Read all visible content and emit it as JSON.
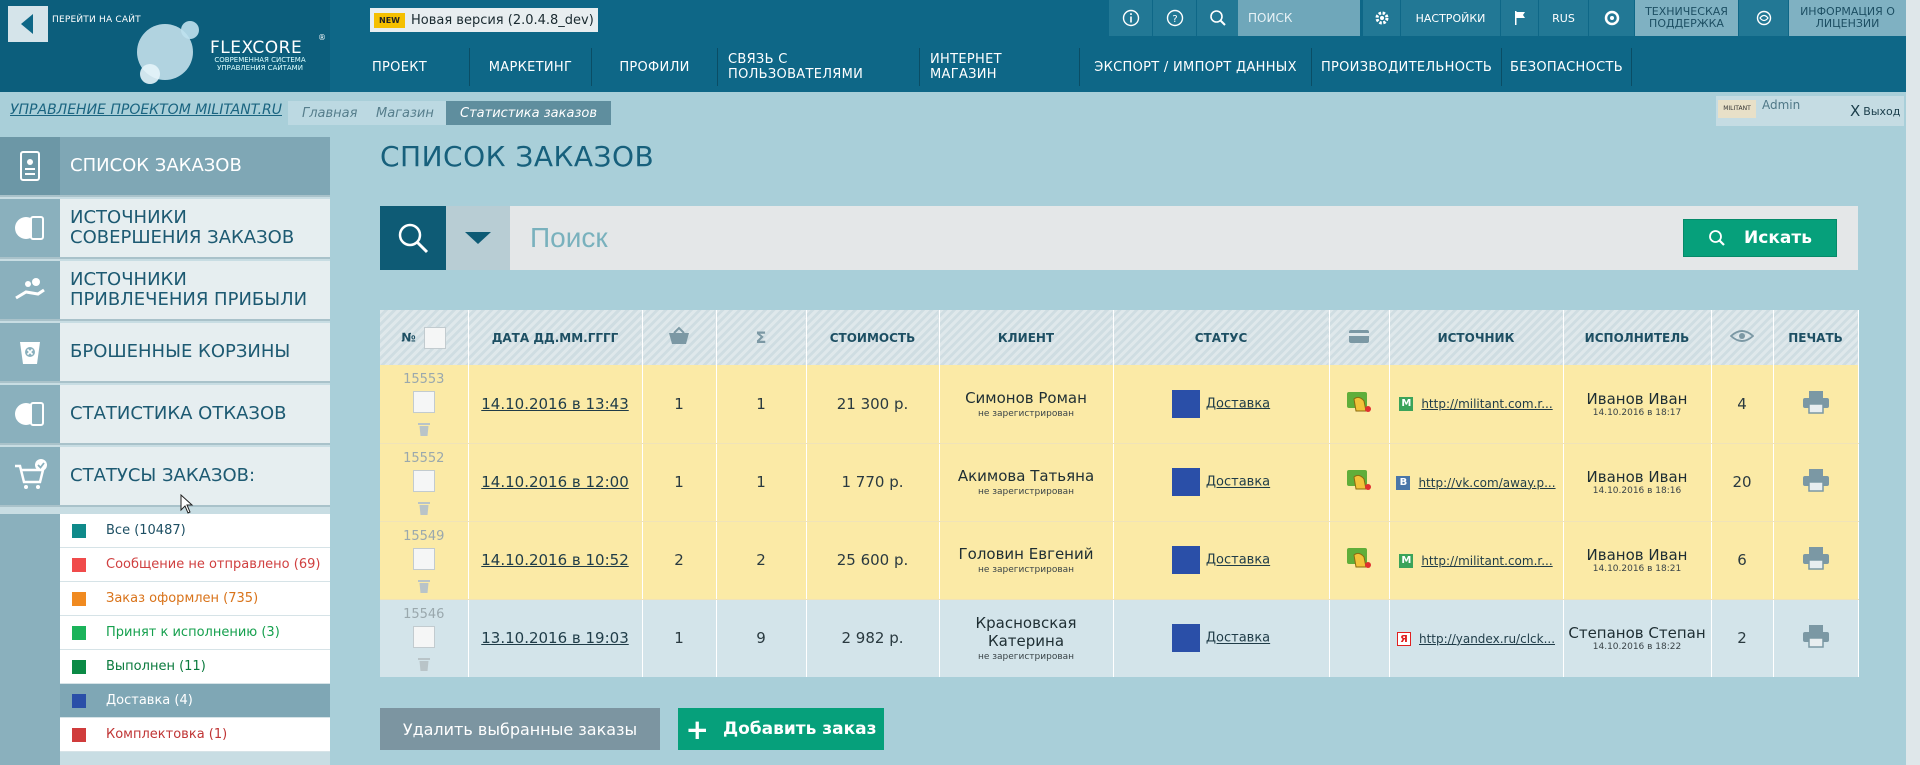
{
  "header": {
    "back_label": "ПЕРЕЙТИ НА САЙТ",
    "brand": "FLEXCORE",
    "brand_reg": "®",
    "tagline": "СОВРЕМЕННАЯ СИСТЕМА УПРАВЛЕНИЯ САЙТАМИ",
    "new_badge": "NEW",
    "version": "Новая версия (2.0.4.8_dev)",
    "search_placeholder": "ПОИСК",
    "settings": "НАСТРОЙКИ",
    "lang": "RUS",
    "support": "ТЕХНИЧЕСКАЯ ПОДДЕРЖКА",
    "license": "ИНФОРМАЦИЯ О ЛИЦЕНЗИИ"
  },
  "nav": [
    "ПРОЕКТ",
    "МАРКЕТИНГ",
    "ПРОФИЛИ",
    "СВЯЗЬ С ПОЛЬЗОВАТЕЛЯМИ",
    "ИНТЕРНЕТ МАГАЗИН",
    "ЭКСПОРТ / ИМПОРТ ДАННЫХ",
    "ПРОИЗВОДИТЕЛЬНОСТЬ",
    "БЕЗОПАСНОСТЬ"
  ],
  "breadcrumb": {
    "project": "УПРАВЛЕНИЕ ПРОЕКТОМ MILITANT.RU",
    "items": [
      "Главная",
      "Магазин",
      "Статистика заказов"
    ]
  },
  "user": {
    "logo": "MILITANT",
    "name": "Admin",
    "logout_x": "X",
    "logout": "Выход"
  },
  "sidebar": {
    "items": [
      "СПИСОК ЗАКАЗОВ",
      "ИСТОЧНИКИ СОВЕРШЕНИЯ ЗАКАЗОВ",
      "ИСТОЧНИКИ ПРИВЛЕЧЕНИЯ ПРИБЫЛИ",
      "БРОШЕННЫЕ КОРЗИНЫ",
      "СТАТИСТИКА ОТКАЗОВ",
      "СТАТУСЫ ЗАКАЗОВ:"
    ],
    "statuses": [
      {
        "label": "Все (10487)",
        "color": "#0f8a8a",
        "text": "#1d4f63"
      },
      {
        "label": "Сообщение не отправлено (69)",
        "color": "#f04b4b",
        "text": "#d04040"
      },
      {
        "label": "Заказ оформлен (735)",
        "color": "#f08a20",
        "text": "#d9731a"
      },
      {
        "label": "Принят к исполнению (3)",
        "color": "#1bb35a",
        "text": "#16a04e"
      },
      {
        "label": "Выполнен (11)",
        "color": "#0b8a45",
        "text": "#0a7a3d"
      },
      {
        "label": "Доставка (4)",
        "color": "#2a4fa8",
        "text": "#ffffff"
      },
      {
        "label": "Комплектовка (1)",
        "color": "#d03c3c",
        "text": "#c03535"
      }
    ]
  },
  "page_title": "СПИСОК ЗАКАЗОВ",
  "search": {
    "placeholder": "Поиск",
    "button": "Искать"
  },
  "table": {
    "headers": {
      "num": "№",
      "date": "ДАТА ДД.ММ.ГГГГ",
      "sum": "Σ",
      "cost": "СТОИМОСТЬ",
      "client": "КЛИЕНТ",
      "status": "СТАТУС",
      "source": "ИСТОЧНИК",
      "executor": "ИСПОЛНИТЕЛЬ",
      "print": "ПЕЧАТЬ"
    },
    "rows": [
      {
        "id": "15553",
        "date": "14.10.2016 в 13:43",
        "qty": "1",
        "sum": "1",
        "cost": "21 300 р.",
        "client": "Симонов Роман",
        "client_note": "не зарегистрирован",
        "status": "Доставка",
        "src_icon": "M",
        "source": "http://militant.com.r...",
        "executor": "Иванов Иван",
        "exec_date": "14.10.2016 в 18:17",
        "views": "4"
      },
      {
        "id": "15552",
        "date": "14.10.2016 в 12:00",
        "qty": "1",
        "sum": "1",
        "cost": "1 770 р.",
        "client": "Акимова Татьяна",
        "client_note": "не зарегистрирован",
        "status": "Доставка",
        "src_icon": "В",
        "source": "http://vk.com/away.p...",
        "executor": "Иванов Иван",
        "exec_date": "14.10.2016 в 18:16",
        "views": "20"
      },
      {
        "id": "15549",
        "date": "14.10.2016 в 10:52",
        "qty": "2",
        "sum": "2",
        "cost": "25 600 р.",
        "client": "Головин Евгений",
        "client_note": "не зарегистрирован",
        "status": "Доставка",
        "src_icon": "M",
        "source": "http://militant.com.r...",
        "executor": "Иванов Иван",
        "exec_date": "14.10.2016 в 18:21",
        "views": "6"
      },
      {
        "id": "15546",
        "date": "13.10.2016 в 19:03",
        "qty": "1",
        "sum": "9",
        "cost": "2 982 р.",
        "client": "Красновская Катерина",
        "client_note": "не зарегистрирован",
        "status": "Доставка",
        "src_icon": "Я",
        "source": "http://yandex.ru/clck...",
        "executor": "Степанов Степан",
        "exec_date": "14.10.2016 в 18:22",
        "views": "2"
      }
    ]
  },
  "actions": {
    "delete": "Удалить выбранные заказы",
    "add_plus": "+",
    "add": "Добавить заказ"
  }
}
